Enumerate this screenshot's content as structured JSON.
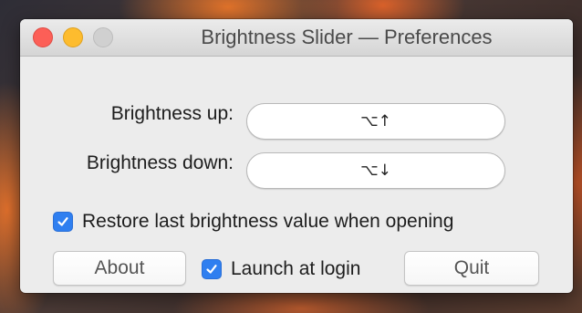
{
  "window": {
    "title": "Brightness Slider — Preferences"
  },
  "shortcuts": {
    "up_label": "Brightness up:",
    "up_value": "⌥↑",
    "down_label": "Brightness down:",
    "down_value": "⌥↓"
  },
  "options": {
    "restore_label": "Restore last brightness value when opening",
    "restore_checked": true,
    "launch_label": "Launch at login",
    "launch_checked": true
  },
  "buttons": {
    "about": "About",
    "quit": "Quit"
  },
  "colors": {
    "close": "#fc5f57",
    "minimize": "#fdbc2e",
    "zoom_disabled": "#d0d0d0",
    "checkbox_accent": "#2f7ff0"
  }
}
